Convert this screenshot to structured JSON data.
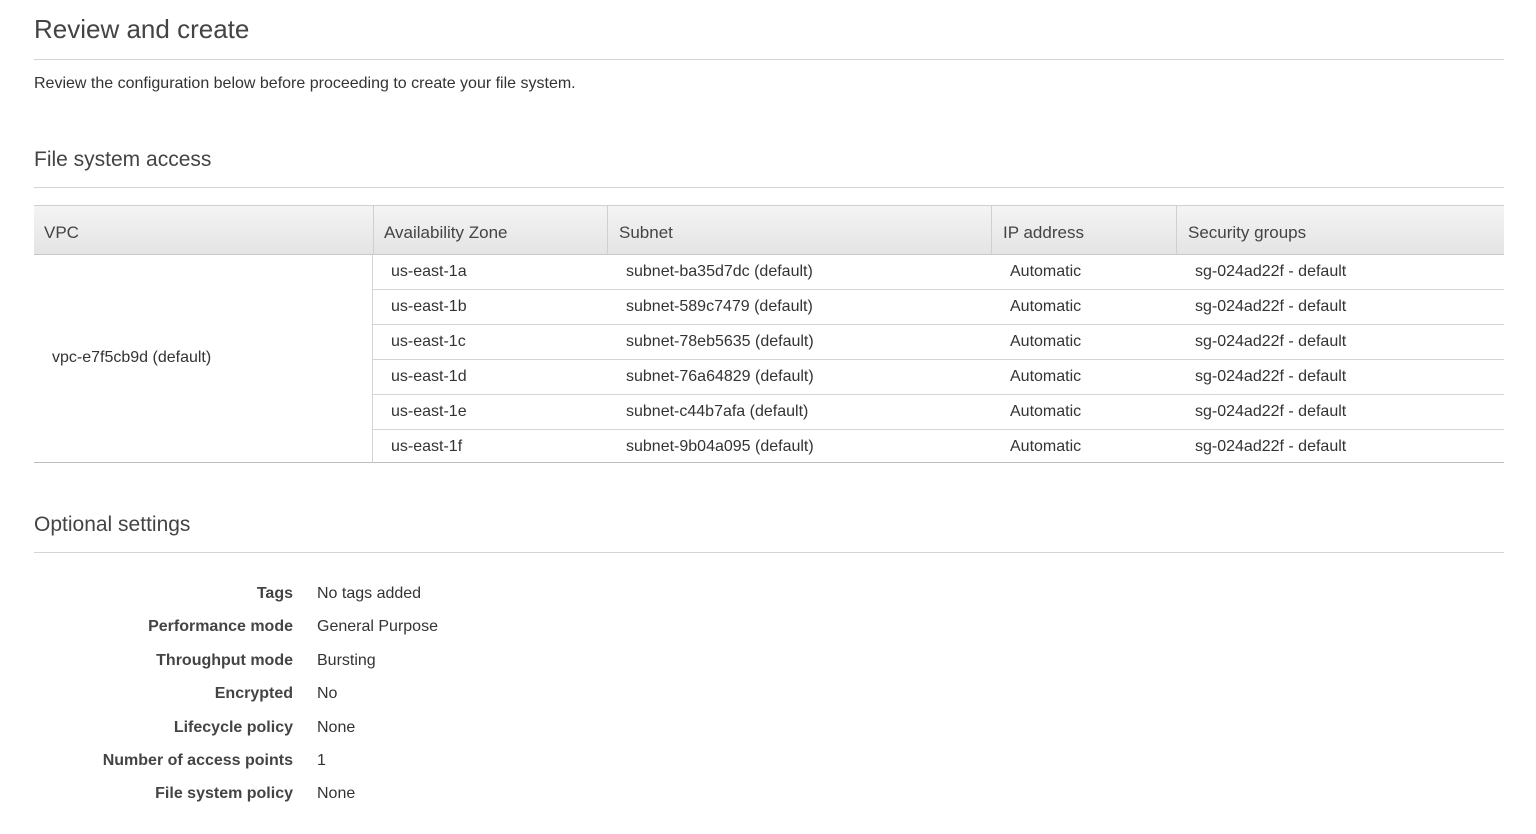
{
  "header": {
    "title": "Review and create",
    "description": "Review the configuration below before proceeding to create your file system."
  },
  "access": {
    "title": "File system access",
    "columns": [
      "VPC",
      "Availability Zone",
      "Subnet",
      "IP address",
      "Security groups"
    ],
    "vpc": "vpc-e7f5cb9d (default)",
    "rows": [
      {
        "az": "us-east-1a",
        "subnet": "subnet-ba35d7dc (default)",
        "ip": "Automatic",
        "sg": "sg-024ad22f - default"
      },
      {
        "az": "us-east-1b",
        "subnet": "subnet-589c7479 (default)",
        "ip": "Automatic",
        "sg": "sg-024ad22f - default"
      },
      {
        "az": "us-east-1c",
        "subnet": "subnet-78eb5635 (default)",
        "ip": "Automatic",
        "sg": "sg-024ad22f - default"
      },
      {
        "az": "us-east-1d",
        "subnet": "subnet-76a64829 (default)",
        "ip": "Automatic",
        "sg": "sg-024ad22f - default"
      },
      {
        "az": "us-east-1e",
        "subnet": "subnet-c44b7afa (default)",
        "ip": "Automatic",
        "sg": "sg-024ad22f - default"
      },
      {
        "az": "us-east-1f",
        "subnet": "subnet-9b04a095 (default)",
        "ip": "Automatic",
        "sg": "sg-024ad22f - default"
      }
    ]
  },
  "optional": {
    "title": "Optional settings",
    "settings": [
      {
        "label": "Tags",
        "value": "No tags added"
      },
      {
        "label": "Performance mode",
        "value": "General Purpose"
      },
      {
        "label": "Throughput mode",
        "value": "Bursting"
      },
      {
        "label": "Encrypted",
        "value": "No"
      },
      {
        "label": "Lifecycle policy",
        "value": "None"
      },
      {
        "label": "Number of access points",
        "value": "1"
      },
      {
        "label": "File system policy",
        "value": "None"
      }
    ]
  }
}
